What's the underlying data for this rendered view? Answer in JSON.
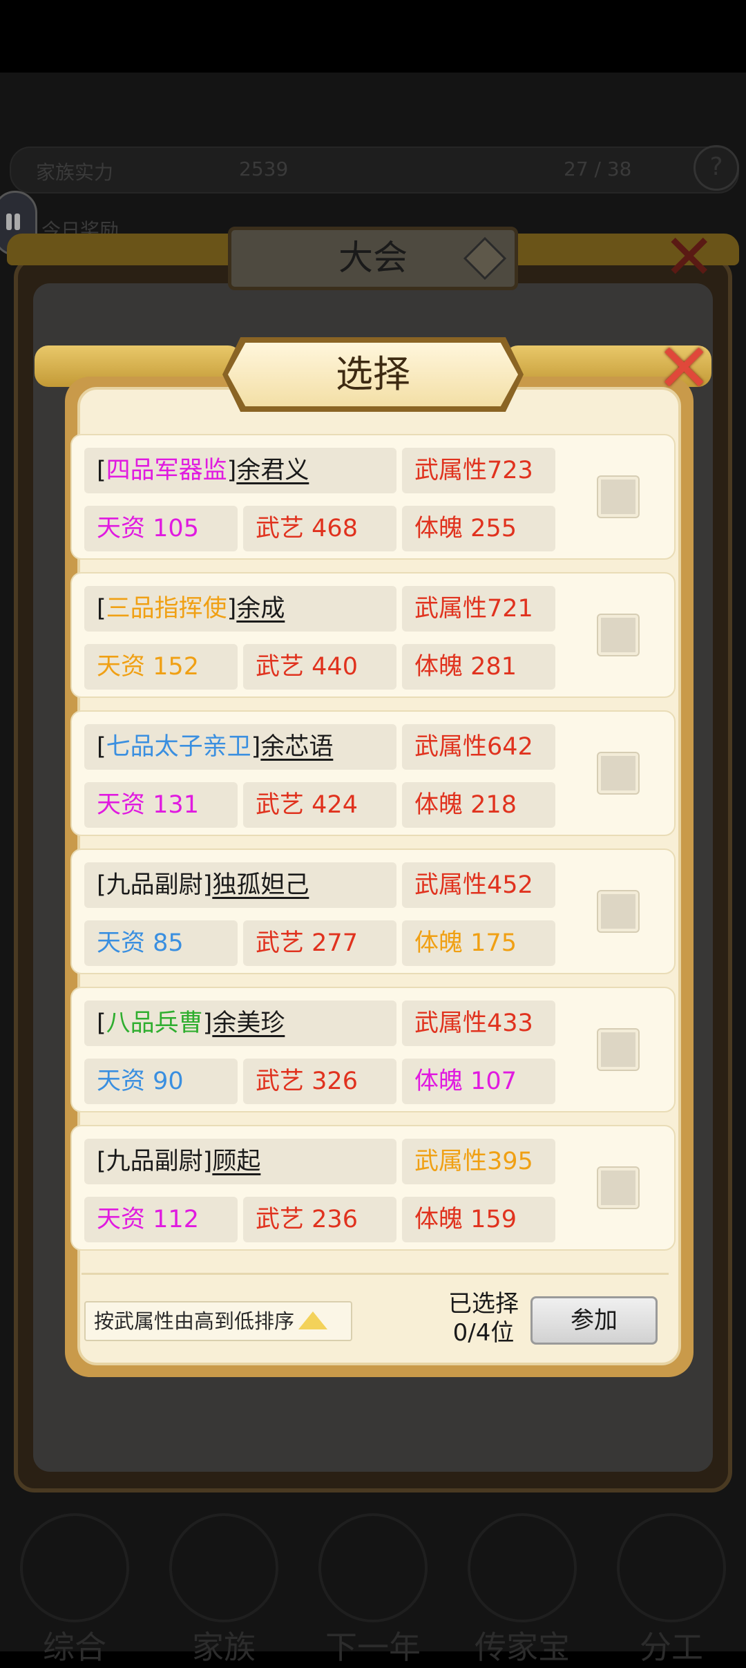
{
  "background": {
    "outer_title": "大会",
    "bg_text_left": "家族实力",
    "bg_text_mid": "2539",
    "bg_text_right": "27 / 38",
    "bg_row2": "今日奖励",
    "nav": [
      "综合",
      "家族",
      "下一年",
      "传家宝",
      "分工"
    ]
  },
  "dialog": {
    "title": "选择",
    "close": "X"
  },
  "candidates": [
    {
      "rank": "四品军器监",
      "rank_color": "magenta",
      "name": "余君义",
      "attr_label": "武属性",
      "attr": "723",
      "attr_color": "red",
      "tz_label": "天资",
      "tz": "105",
      "tz_color": "magenta",
      "wy_label": "武艺",
      "wy": "468",
      "wy_color": "red",
      "tp_label": "体魄",
      "tp": "255",
      "tp_color": "red"
    },
    {
      "rank": "三品指挥使",
      "rank_color": "orange",
      "name": "余成",
      "attr_label": "武属性",
      "attr": "721",
      "attr_color": "red",
      "tz_label": "天资",
      "tz": "152",
      "tz_color": "orange",
      "wy_label": "武艺",
      "wy": "440",
      "wy_color": "red",
      "tp_label": "体魄",
      "tp": "281",
      "tp_color": "red"
    },
    {
      "rank": "七品太子亲卫",
      "rank_color": "blue",
      "name": "余芯语",
      "attr_label": "武属性",
      "attr": "642",
      "attr_color": "red",
      "tz_label": "天资",
      "tz": "131",
      "tz_color": "magenta",
      "wy_label": "武艺",
      "wy": "424",
      "wy_color": "red",
      "tp_label": "体魄",
      "tp": "218",
      "tp_color": "red"
    },
    {
      "rank": "九品副尉",
      "rank_color": "black",
      "name": "独孤妲己",
      "attr_label": "武属性",
      "attr": "452",
      "attr_color": "red",
      "tz_label": "天资",
      "tz": "85",
      "tz_color": "blue",
      "wy_label": "武艺",
      "wy": "277",
      "wy_color": "red",
      "tp_label": "体魄",
      "tp": "175",
      "tp_color": "orange"
    },
    {
      "rank": "八品兵曹",
      "rank_color": "green",
      "name": "余美珍",
      "attr_label": "武属性",
      "attr": "433",
      "attr_color": "red",
      "tz_label": "天资",
      "tz": "90",
      "tz_color": "blue",
      "wy_label": "武艺",
      "wy": "326",
      "wy_color": "red",
      "tp_label": "体魄",
      "tp": "107",
      "tp_color": "magenta"
    },
    {
      "rank": "九品副尉",
      "rank_color": "black",
      "name": "顾起",
      "attr_label": "武属性",
      "attr": "395",
      "attr_color": "orange",
      "tz_label": "天资",
      "tz": "112",
      "tz_color": "magenta",
      "wy_label": "武艺",
      "wy": "236",
      "wy_color": "red",
      "tp_label": "体魄",
      "tp": "159",
      "tp_color": "red"
    }
  ],
  "footer": {
    "sort_label": "按武属性由高到低排序",
    "selected_label": "已选择",
    "selected_count": "0/4位",
    "join_button": "参加"
  },
  "colors": {
    "magenta": "#e01ae0",
    "orange": "#f0a014",
    "blue": "#3a8fe0",
    "green": "#2fae2f",
    "red": "#e0321e",
    "black": "#1a1a1a"
  }
}
